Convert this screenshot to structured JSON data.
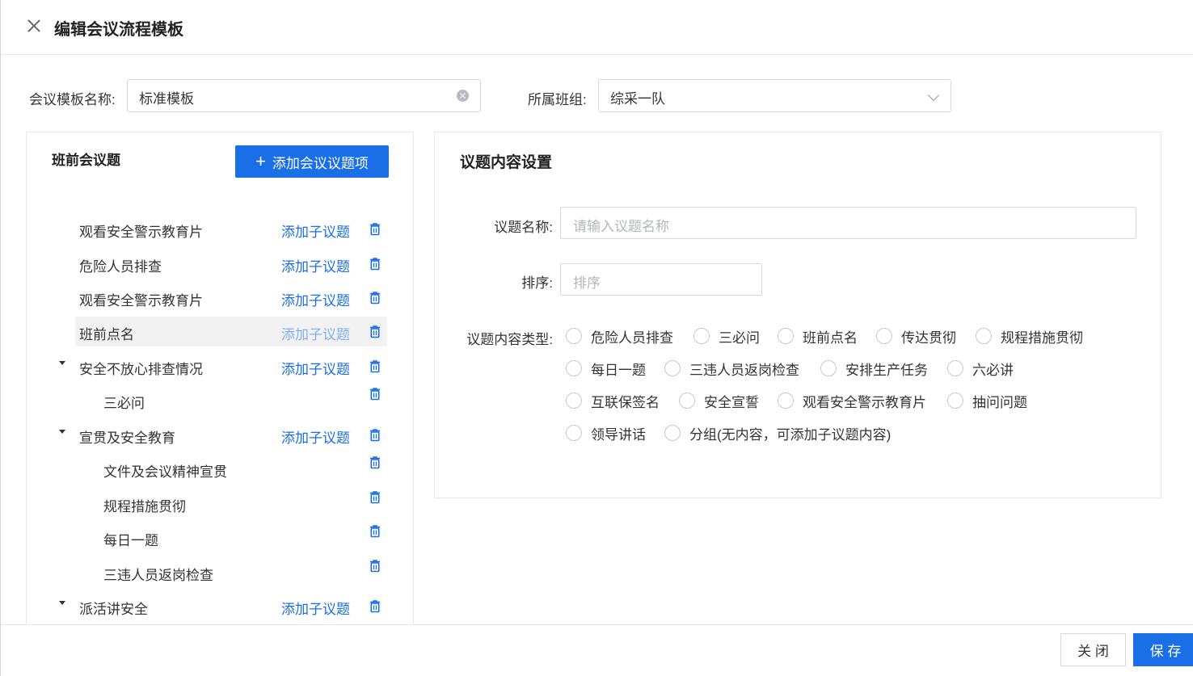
{
  "dialog": {
    "title": "编辑会议流程模板"
  },
  "form": {
    "template_name_label": "会议模板名称:",
    "template_name_value": "标准模板",
    "team_label": "所属班组:",
    "team_value": "综采一队"
  },
  "left_panel": {
    "title": "班前会议题",
    "add_button_label": "添加会议议题项",
    "add_sub_label": "添加子议题",
    "items": [
      {
        "label": "观看安全警示教育片",
        "level": 0,
        "expanded": false,
        "selected": false,
        "has_add": true
      },
      {
        "label": "危险人员排查",
        "level": 0,
        "expanded": false,
        "selected": false,
        "has_add": true
      },
      {
        "label": "观看安全警示教育片",
        "level": 0,
        "expanded": false,
        "selected": false,
        "has_add": true
      },
      {
        "label": "班前点名",
        "level": 0,
        "expanded": false,
        "selected": true,
        "has_add": true
      },
      {
        "label": "安全不放心排查情况",
        "level": 0,
        "expanded": true,
        "selected": false,
        "has_add": true
      },
      {
        "label": "三必问",
        "level": 1,
        "expanded": false,
        "selected": false,
        "has_add": false
      },
      {
        "label": "宣贯及安全教育",
        "level": 0,
        "expanded": true,
        "selected": false,
        "has_add": true
      },
      {
        "label": "文件及会议精神宣贯",
        "level": 1,
        "expanded": false,
        "selected": false,
        "has_add": false
      },
      {
        "label": "规程措施贯彻",
        "level": 1,
        "expanded": false,
        "selected": false,
        "has_add": false
      },
      {
        "label": "每日一题",
        "level": 1,
        "expanded": false,
        "selected": false,
        "has_add": false
      },
      {
        "label": "三违人员返岗检查",
        "level": 1,
        "expanded": false,
        "selected": false,
        "has_add": false
      },
      {
        "label": "派活讲安全",
        "level": 0,
        "expanded": true,
        "selected": false,
        "has_add": true
      }
    ]
  },
  "right_panel": {
    "title": "议题内容设置",
    "topic_name_label": "议题名称:",
    "topic_name_placeholder": "请输入议题名称",
    "order_label": "排序:",
    "order_placeholder": "排序",
    "content_type_label": "议题内容类型:",
    "content_types": [
      "危险人员排查",
      "三必问",
      "班前点名",
      "传达贯彻",
      "规程措施贯彻",
      "每日一题",
      "三违人员返岗检查",
      "安排生产任务",
      "六必讲",
      "互联保签名",
      "安全宣誓",
      "观看安全警示教育片",
      "抽问问题",
      "领导讲话",
      "分组(无内容，可添加子议题内容)"
    ]
  },
  "footer": {
    "close_label": "关 闭",
    "save_label": "保 存"
  },
  "colors": {
    "primary": "#1a6ee6",
    "border": "#e6e8ec",
    "selected_row": "#f2f2f2"
  }
}
